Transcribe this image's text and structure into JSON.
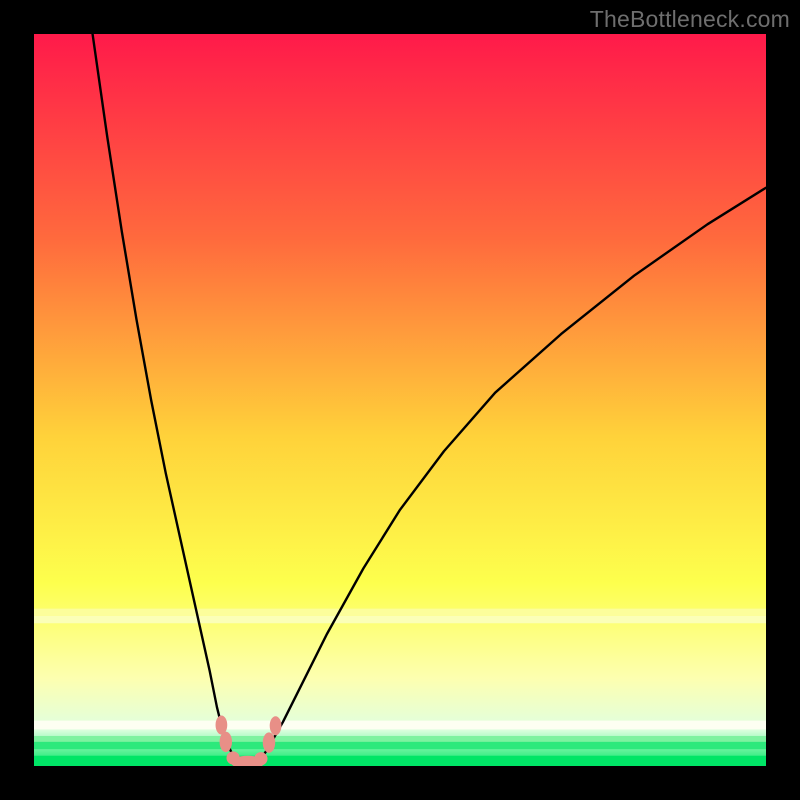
{
  "watermark": "TheBottleneck.com",
  "colors": {
    "frame": "#000000",
    "grad_top": "#ff1a4a",
    "grad_mid_upper": "#ff7a3a",
    "grad_mid": "#ffd23a",
    "grad_mid_lower": "#fbff55",
    "grad_low": "#faffb8",
    "grad_bottom": "#00e865",
    "curve": "#000000",
    "marker_fill": "#e88f87",
    "marker_stroke": "#d97a72"
  },
  "chart_data": {
    "type": "line",
    "title": "",
    "xlabel": "",
    "ylabel": "",
    "xlim": [
      0,
      100
    ],
    "ylim": [
      0,
      100
    ],
    "series": [
      {
        "name": "left-branch",
        "x": [
          8,
          10,
          12,
          14,
          16,
          18,
          20,
          22,
          24,
          25,
          26,
          27,
          27.5
        ],
        "y": [
          100,
          86,
          73,
          61,
          50,
          40,
          31,
          22,
          13,
          8,
          4,
          1.8,
          0.9
        ]
      },
      {
        "name": "right-branch",
        "x": [
          31,
          32,
          34,
          36,
          40,
          45,
          50,
          56,
          63,
          72,
          82,
          92,
          100
        ],
        "y": [
          0.9,
          2.5,
          6,
          10,
          18,
          27,
          35,
          43,
          51,
          59,
          67,
          74,
          79
        ]
      },
      {
        "name": "valley-floor",
        "x": [
          27.5,
          28,
          29,
          30,
          30.5,
          31
        ],
        "y": [
          0.9,
          0.4,
          0.2,
          0.2,
          0.4,
          0.9
        ]
      }
    ],
    "markers": [
      {
        "name": "floor-blob-center",
        "cx": 29.2,
        "cy": 0.5,
        "rx": 2.3,
        "ry": 0.9
      },
      {
        "name": "floor-blob-left",
        "cx": 27.2,
        "cy": 1.1,
        "rx": 0.9,
        "ry": 0.9
      },
      {
        "name": "floor-blob-right",
        "cx": 31.0,
        "cy": 1.0,
        "rx": 0.9,
        "ry": 0.9
      },
      {
        "name": "left-branch-low",
        "cx": 26.2,
        "cy": 3.3,
        "rx": 0.85,
        "ry": 1.4
      },
      {
        "name": "left-branch-high",
        "cx": 25.6,
        "cy": 5.6,
        "rx": 0.8,
        "ry": 1.3
      },
      {
        "name": "right-branch-low",
        "cx": 32.1,
        "cy": 3.2,
        "rx": 0.85,
        "ry": 1.4
      },
      {
        "name": "right-branch-high",
        "cx": 33.0,
        "cy": 5.5,
        "rx": 0.8,
        "ry": 1.3
      }
    ],
    "gradient_bands": [
      {
        "name": "yellow-band-top",
        "y": 20.5,
        "h": 1.0,
        "color": "#fcfe9b"
      },
      {
        "name": "yellow-band-bottom",
        "y": 19.5,
        "h": 1.0,
        "color": "#fbffb8"
      },
      {
        "name": "white-band",
        "y": 5.0,
        "h": 1.2,
        "color": "#fdfff2"
      },
      {
        "name": "green-top",
        "y": 3.2,
        "h": 0.9,
        "color": "#7ef2a0"
      },
      {
        "name": "green-mid",
        "y": 2.3,
        "h": 1.0,
        "color": "#2de97c"
      },
      {
        "name": "green-bottom",
        "y": 0.0,
        "h": 1.4,
        "color": "#00e566"
      }
    ]
  }
}
